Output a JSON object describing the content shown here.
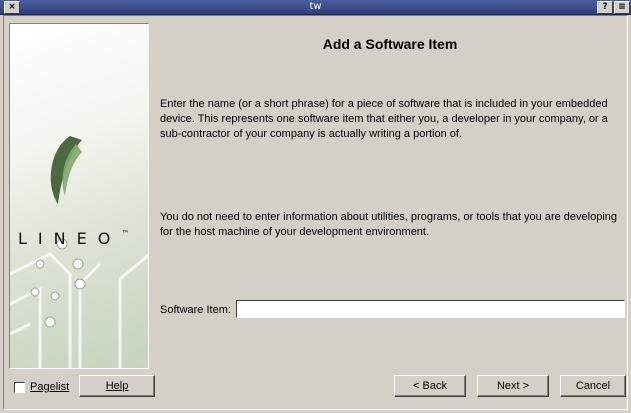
{
  "window": {
    "title": "tw",
    "close_glyph": "×",
    "help_glyph": "?",
    "menu_glyph": "≡"
  },
  "sidebar": {
    "logo_text": "LINEO",
    "logo_trademark": "™"
  },
  "main": {
    "heading": "Add a Software Item",
    "paragraph1": "Enter the name (or a short phrase) for a piece of software that is included in your embedded device. This represents one software item that either you, a developer in your company, or a sub-contractor of your company is actually writing a portion of.",
    "paragraph2": "You do not need to enter information about utilities, programs, or tools that you are developing for the host machine of your development environment.",
    "field_label": "Software Item:",
    "field_value": ""
  },
  "footer": {
    "pagelist_label": "Pagelist",
    "pagelist_checked": false,
    "help_label": "Help",
    "back_label": "< Back",
    "next_label": "Next >",
    "cancel_label": "Cancel"
  },
  "colors": {
    "titlebar": "#2e3f7a",
    "window_bg": "#d4d0c8",
    "panel_gradient_end": "#c7d2bf"
  }
}
